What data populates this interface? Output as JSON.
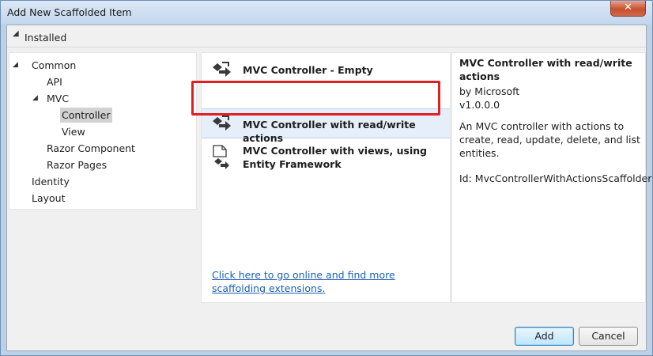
{
  "window": {
    "title": "Add New Scaffolded Item",
    "close_label": "✕"
  },
  "installed": {
    "label": "Installed",
    "arrow": "◢"
  },
  "tree": {
    "common": "Common",
    "api": "API",
    "mvc": "MVC",
    "controller": "Controller",
    "view": "View",
    "razor_component": "Razor Component",
    "razor_pages": "Razor Pages",
    "identity": "Identity",
    "layout": "Layout",
    "expanded_arrow": "◢"
  },
  "items": [
    {
      "label": "MVC Controller - Empty",
      "icon": "controller-icon"
    },
    {
      "label": "MVC Controller with read/write actions",
      "icon": "controller-icon"
    },
    {
      "label": "MVC Controller with views, using Entity Framework",
      "icon": "controller-views-icon"
    }
  ],
  "online_link": "Click here to go online and find more scaffolding extensions.",
  "detail": {
    "title": "MVC Controller with read/write actions",
    "by": "by Microsoft",
    "version": "v1.0.0.0",
    "description": "An MVC controller with actions to create, read, update, delete, and list entities.",
    "id": "Id: MvcControllerWithActionsScaffolder"
  },
  "buttons": {
    "add": "Add",
    "cancel": "Cancel"
  },
  "colors": {
    "selection_outline": "#e02020",
    "link": "#1a5fb4"
  }
}
